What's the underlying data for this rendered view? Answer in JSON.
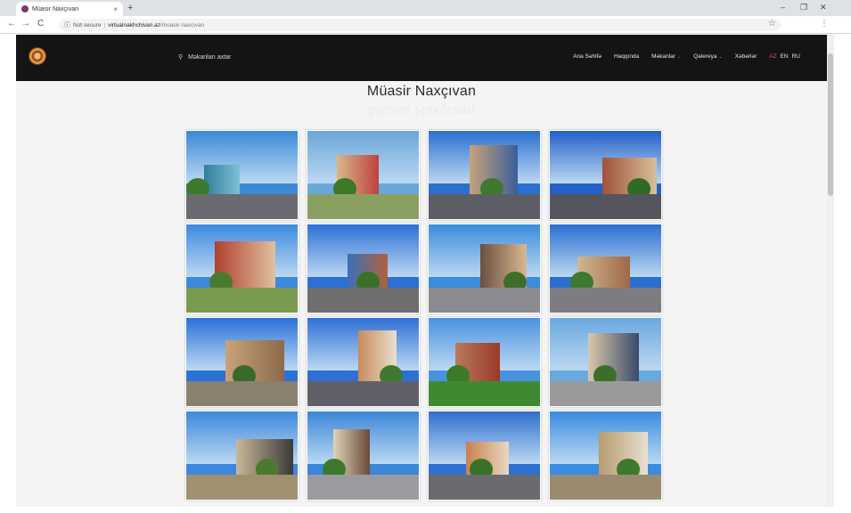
{
  "browser": {
    "tab_title": "Müasir Naxçıvan",
    "tab_close": "×",
    "new_tab": "+",
    "security_label": "Not secure",
    "url_host": "virtualnakhchivan.az",
    "url_path": "/muasir-naxcivan",
    "win_min": "–",
    "win_max": "❐",
    "win_close": "✕",
    "back": "←",
    "forward": "→",
    "reload": "C",
    "star": "☆",
    "menu": "⋮"
  },
  "site": {
    "search_placeholder": "Məkanları axtar",
    "nav": [
      {
        "label": "Ana Səhifə",
        "caret": false
      },
      {
        "label": "Haqqında",
        "caret": false
      },
      {
        "label": "Məkanlar",
        "caret": true
      },
      {
        "label": "Qalereya",
        "caret": true
      },
      {
        "label": "Xəbərlər",
        "caret": false
      }
    ],
    "languages": [
      {
        "label": "AZ",
        "active": true
      },
      {
        "label": "EN",
        "active": false
      },
      {
        "label": "RU",
        "active": false
      }
    ],
    "page_title": "Müasir Naxçıvan",
    "caret_glyph": "⌄"
  },
  "gallery": [
    {
      "sky": "#3a8ad8",
      "ground": "#6a6a70",
      "bld": "#2f7f9a",
      "accent": "#7fbfd8",
      "tree": "#3e7a2e"
    },
    {
      "sky": "#6aa7d9",
      "ground": "#8aa060",
      "bld": "#d7b98a",
      "accent": "#c04040",
      "tree": "#3d7a28"
    },
    {
      "sky": "#2b6fcf",
      "ground": "#5d5d66",
      "bld": "#c9a27a",
      "accent": "#3a5f9a",
      "tree": "#3d7a2e"
    },
    {
      "sky": "#2460c8",
      "ground": "#55555e",
      "bld": "#a0523a",
      "accent": "#d8c09a",
      "tree": "#2f6b24"
    },
    {
      "sky": "#3c8ae0",
      "ground": "#7a9a50",
      "bld": "#b0402e",
      "accent": "#e0c0a0",
      "tree": "#4a7a30"
    },
    {
      "sky": "#2c6fd6",
      "ground": "#6e6e6e",
      "bld": "#3a70b8",
      "accent": "#b06040",
      "tree": "#3a7028"
    },
    {
      "sky": "#3a8cdc",
      "ground": "#8a8a90",
      "bld": "#6a5040",
      "accent": "#d8b890",
      "tree": "#3e6e2a"
    },
    {
      "sky": "#2a6ed0",
      "ground": "#7c7c82",
      "bld": "#d0b890",
      "accent": "#a06848",
      "tree": "#3c7a30"
    },
    {
      "sky": "#2a72d8",
      "ground": "#8a8070",
      "bld": "#caa278",
      "accent": "#8a6a4a",
      "tree": "#3a6a28"
    },
    {
      "sky": "#2e70d4",
      "ground": "#606068",
      "bld": "#c88a5a",
      "accent": "#e8e0d0",
      "tree": "#3e7a2e"
    },
    {
      "sky": "#4a92e0",
      "ground": "#3f8a30",
      "bld": "#b87a5a",
      "accent": "#9a3a2a",
      "tree": "#3a7a28"
    },
    {
      "sky": "#6aa8e0",
      "ground": "#9a9a9a",
      "bld": "#d8c8a8",
      "accent": "#3a4a6a",
      "tree": "#3c6e2a"
    },
    {
      "sky": "#3c88dc",
      "ground": "#a09070",
      "bld": "#c8b898",
      "accent": "#3a3a3a",
      "tree": "#4a7a30"
    },
    {
      "sky": "#3a86d8",
      "ground": "#9a9aa0",
      "bld": "#e0d4b8",
      "accent": "#6a4a3a",
      "tree": "#3e7a2e"
    },
    {
      "sky": "#2e6fd0",
      "ground": "#6a6a70",
      "bld": "#c88050",
      "accent": "#e8d8c0",
      "tree": "#3a7028"
    },
    {
      "sky": "#3a8ce0",
      "ground": "#9a8a70",
      "bld": "#b89a70",
      "accent": "#e8e0d0",
      "tree": "#3e7a2e"
    }
  ]
}
